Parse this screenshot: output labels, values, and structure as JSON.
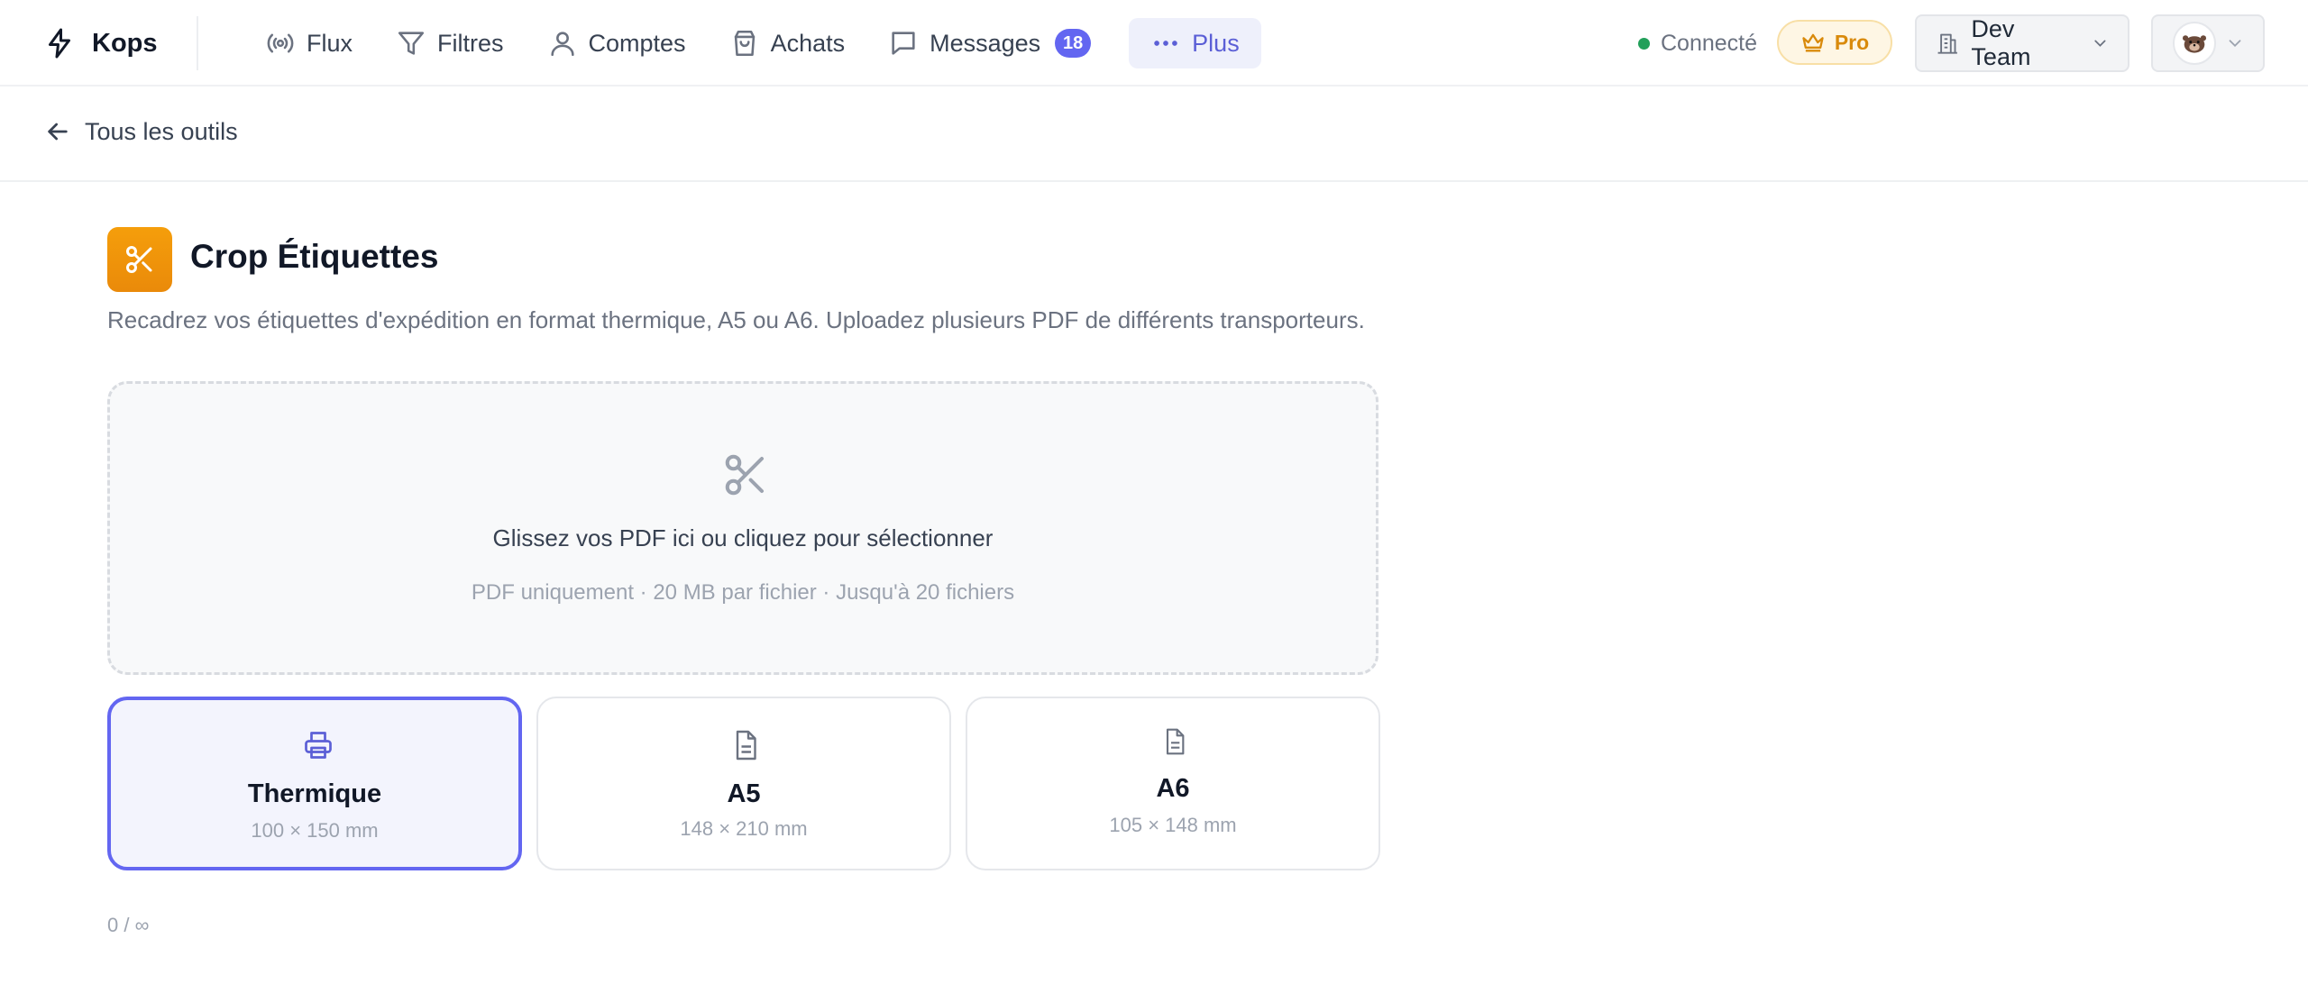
{
  "app": {
    "name": "Kops"
  },
  "nav": {
    "items": [
      {
        "label": "Flux",
        "icon": "broadcast-icon"
      },
      {
        "label": "Filtres",
        "icon": "filter-icon"
      },
      {
        "label": "Comptes",
        "icon": "user-icon"
      },
      {
        "label": "Achats",
        "icon": "shopping-bag-icon"
      },
      {
        "label": "Messages",
        "icon": "message-icon",
        "badge": "18"
      },
      {
        "label": "Plus",
        "icon": "more-icon",
        "active": true
      }
    ]
  },
  "header": {
    "status": "Connecté",
    "status_color": "#22a05a",
    "plan": "Pro",
    "team": "Dev Team"
  },
  "subheader": {
    "back_label": "Tous les outils"
  },
  "tool": {
    "title": "Crop Étiquettes",
    "description": "Recadrez vos étiquettes d'expédition en format thermique, A5 ou A6. Uploadez plusieurs PDF de différents transporteurs.",
    "accent_color": "#f59e0b"
  },
  "dropzone": {
    "main_text": "Glissez vos PDF ici ou cliquez pour sélectionner",
    "hint_text": "PDF uniquement · 20 MB par fichier · Jusqu'à 20 fichiers"
  },
  "formats": [
    {
      "name": "Thermique",
      "dimensions": "100 × 150 mm",
      "icon": "printer-icon",
      "selected": true
    },
    {
      "name": "A5",
      "dimensions": "148 × 210 mm",
      "icon": "document-icon",
      "selected": false
    },
    {
      "name": "A6",
      "dimensions": "105 × 148 mm",
      "icon": "document-icon",
      "selected": false
    }
  ],
  "counter": "0 / ∞",
  "colors": {
    "primary": "#6366f1",
    "pro": "#d98a0b"
  }
}
